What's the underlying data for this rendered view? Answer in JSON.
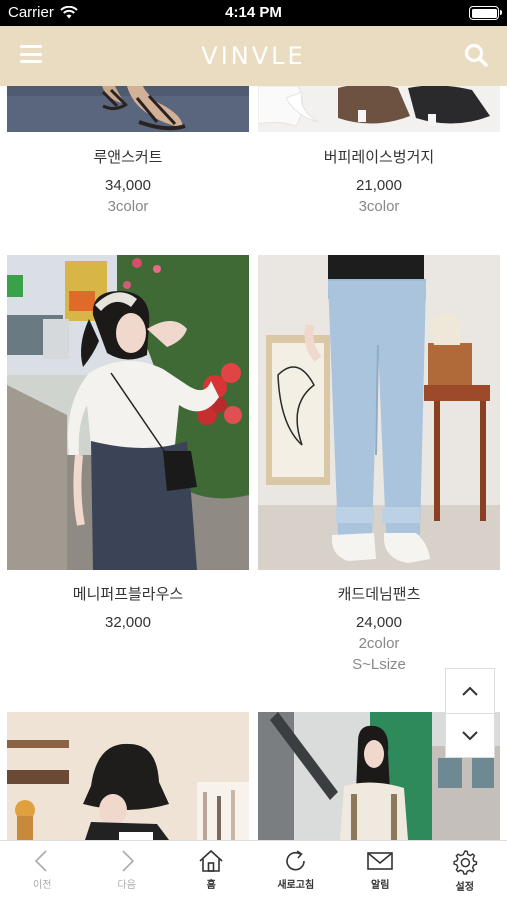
{
  "status_bar": {
    "carrier": "Carrier",
    "time": "4:14 PM"
  },
  "header": {
    "brand": "VINVLE"
  },
  "products": [
    {
      "name": "루앤스커트",
      "price": "34,000",
      "options": [
        "3color"
      ]
    },
    {
      "name": "버피레이스벙거지",
      "price": "21,000",
      "options": [
        "3color"
      ]
    },
    {
      "name": "메니퍼프블라우스",
      "price": "32,000",
      "options": []
    },
    {
      "name": "캐드데님팬츠",
      "price": "24,000",
      "options": [
        "2color",
        "S~Lsize"
      ]
    },
    {
      "name": "",
      "price": "",
      "options": []
    },
    {
      "name": "",
      "price": "",
      "options": []
    }
  ],
  "bottom_nav": [
    {
      "label": "이전",
      "icon": "chevron-left-icon",
      "enabled": false
    },
    {
      "label": "다음",
      "icon": "chevron-right-icon",
      "enabled": false
    },
    {
      "label": "홈",
      "icon": "home-icon",
      "enabled": true
    },
    {
      "label": "새로고침",
      "icon": "refresh-icon",
      "enabled": true
    },
    {
      "label": "알림",
      "icon": "mail-icon",
      "enabled": true
    },
    {
      "label": "설정",
      "icon": "gear-icon",
      "enabled": true
    }
  ],
  "colors": {
    "header_bg": "#e9dcc0",
    "header_text": "#ffffff"
  }
}
